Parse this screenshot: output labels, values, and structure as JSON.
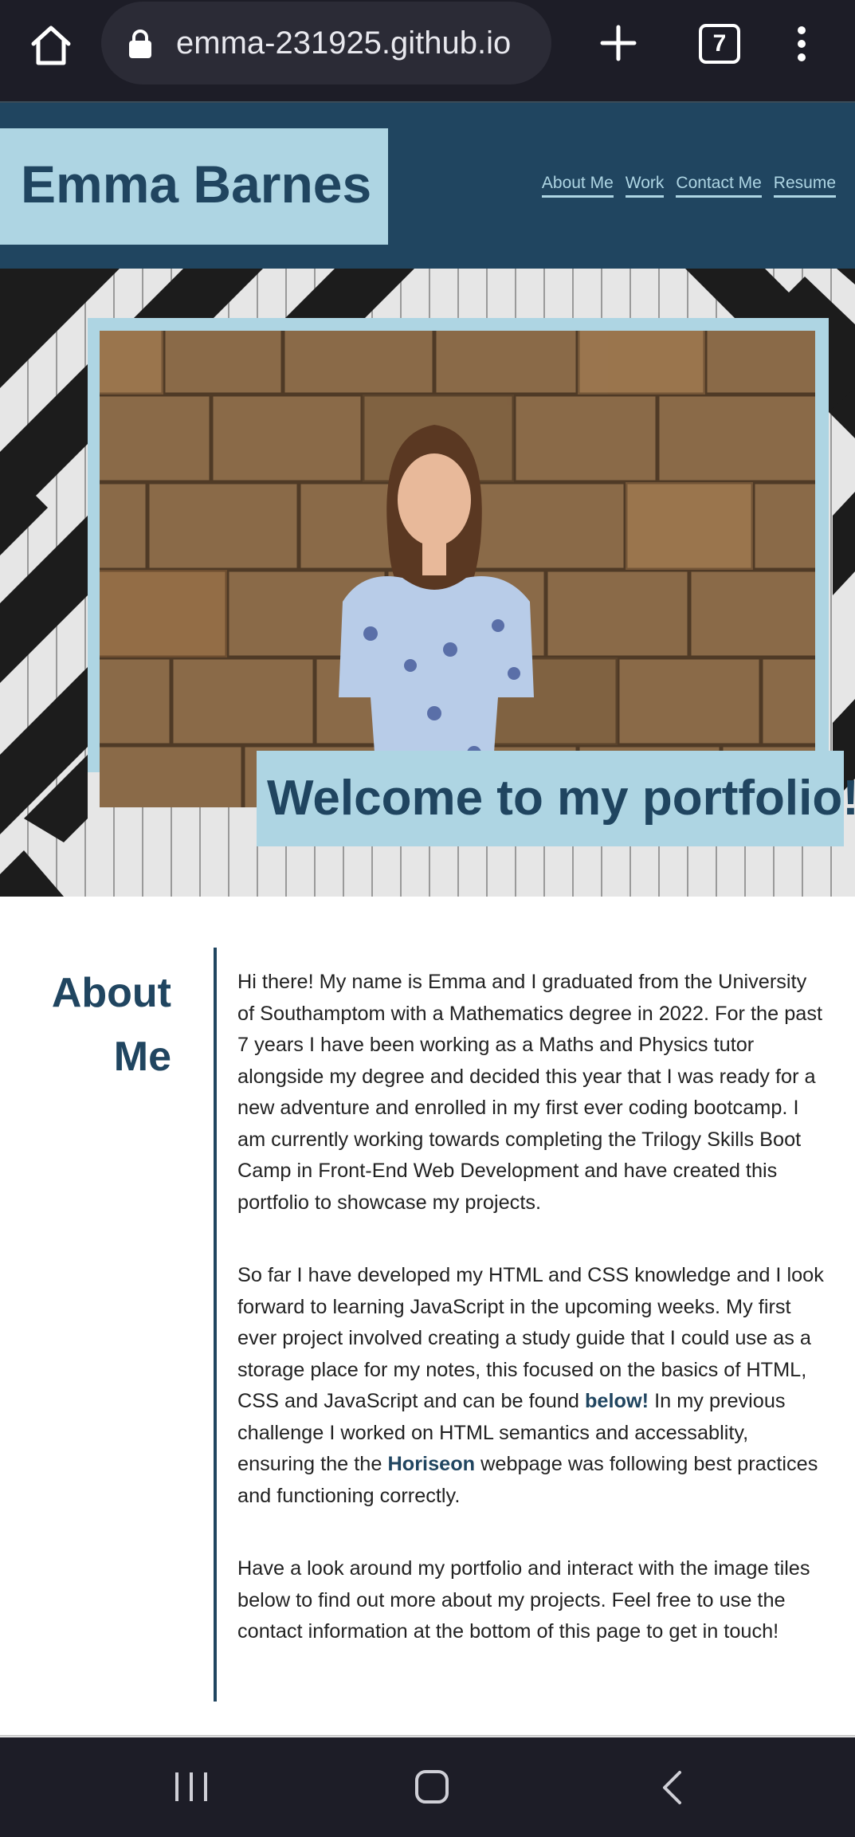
{
  "browser": {
    "url": "emma-231925.github.io",
    "tab_count": "7",
    "icons": [
      "home-icon",
      "lock-icon",
      "plus-icon",
      "tabs-icon",
      "more-vert-icon"
    ]
  },
  "header": {
    "name": "Emma Barnes",
    "nav": [
      "About Me",
      "Work",
      "Contact Me",
      "Resume"
    ]
  },
  "hero": {
    "welcome": "Welcome to my portfolio!"
  },
  "about": {
    "title_line1": "About",
    "title_line2": "Me",
    "p1": "Hi there! My name is Emma and I graduated from the University of Southamptom with a Mathematics degree in 2022. For the past 7 years I have been working as a Maths and Physics tutor alongside my degree and decided this year that I was ready for a new adventure and enrolled in my first ever coding bootcamp. I am currently working towards completing the Trilogy Skills Boot Camp in Front-End Web Development and have created this portfolio to showcase my projects.",
    "p2_a": "So far I have developed my HTML and CSS knowledge and I look forward to learning JavaScript in the upcoming weeks. My first ever project involved creating a study guide that I could use as a storage place for my notes, this focused on the basics of HTML, CSS and JavaScript and can be found ",
    "p2_link1": "below!",
    "p2_b": " In my previous challenge I worked on HTML semantics and accessablity, ensuring the the ",
    "p2_link2": "Horiseon",
    "p2_c": " webpage was following best practices and functioning correctly.",
    "p3": "Have a look around my portfolio and interact with the image tiles below to find out more about my projects. Feel free to use the contact information at the bottom of this page to get in touch!"
  },
  "colors": {
    "brand_dark": "#204560",
    "brand_light": "#aed5e3",
    "chrome": "#1d1d27"
  },
  "system_nav": [
    "recent-apps-icon",
    "home-button-icon",
    "back-icon"
  ]
}
